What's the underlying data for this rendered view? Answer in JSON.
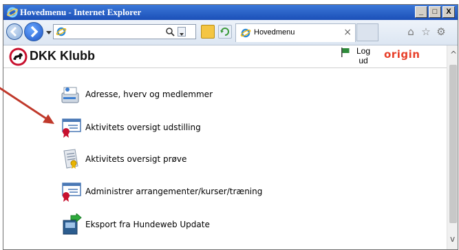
{
  "window": {
    "title": "Hovedmenu - Internet Explorer",
    "controls": {
      "minimize": "_",
      "maximize": "□",
      "close": "X"
    }
  },
  "browser": {
    "address_value": "",
    "tab_label": "Hovedmenu",
    "tab_close": "×"
  },
  "header": {
    "brand": "DKK Klubb",
    "logout_label": "Log ud",
    "partner_logo": "origin"
  },
  "menu": {
    "items": [
      {
        "label": "Adresse, hverv og medlemmer",
        "icon": "address-book-icon"
      },
      {
        "label": "Aktivitets oversigt udstilling",
        "icon": "certificate-icon"
      },
      {
        "label": "Aktivitets oversigt prøve",
        "icon": "document-award-icon"
      },
      {
        "label": "Administrer arrangementer/kurser/træning",
        "icon": "certificate-icon"
      },
      {
        "label": "Eksport fra Hundeweb Update",
        "icon": "export-icon"
      }
    ]
  },
  "annotation": {
    "arrow_color": "#c0392b"
  },
  "colors": {
    "titlebar": "#1b4fb8",
    "origin": "#e8402a"
  }
}
